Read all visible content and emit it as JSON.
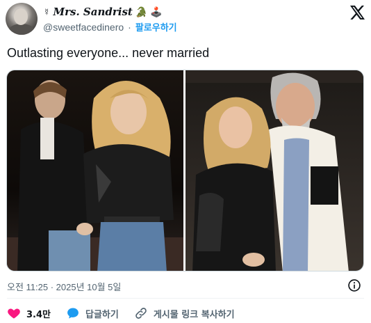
{
  "author": {
    "display_name": "Mrs. Sandrist",
    "badge_emojis": [
      "☿",
      "🐊",
      "🕹️"
    ],
    "handle": "@sweetfacedinero",
    "follow_label": "팔로우하기",
    "separator": "·"
  },
  "tweet": {
    "text": "Outlasting everyone... never married",
    "timestamp": "오전 11:25 · 2025년 10월 5일"
  },
  "actions": {
    "like_count": "3.4만",
    "reply_label": "답글하기",
    "copy_link_label": "게시물 링크 복사하기"
  },
  "colors": {
    "text": "#0f1419",
    "secondary": "#536471",
    "accent": "#1d9bf0",
    "like": "#f91880",
    "divider": "#eff3f4"
  },
  "icons": {
    "brand": "x-logo-icon",
    "info": "info-icon",
    "like": "heart-icon",
    "reply": "reply-bubble-icon",
    "copy_link": "link-icon"
  }
}
